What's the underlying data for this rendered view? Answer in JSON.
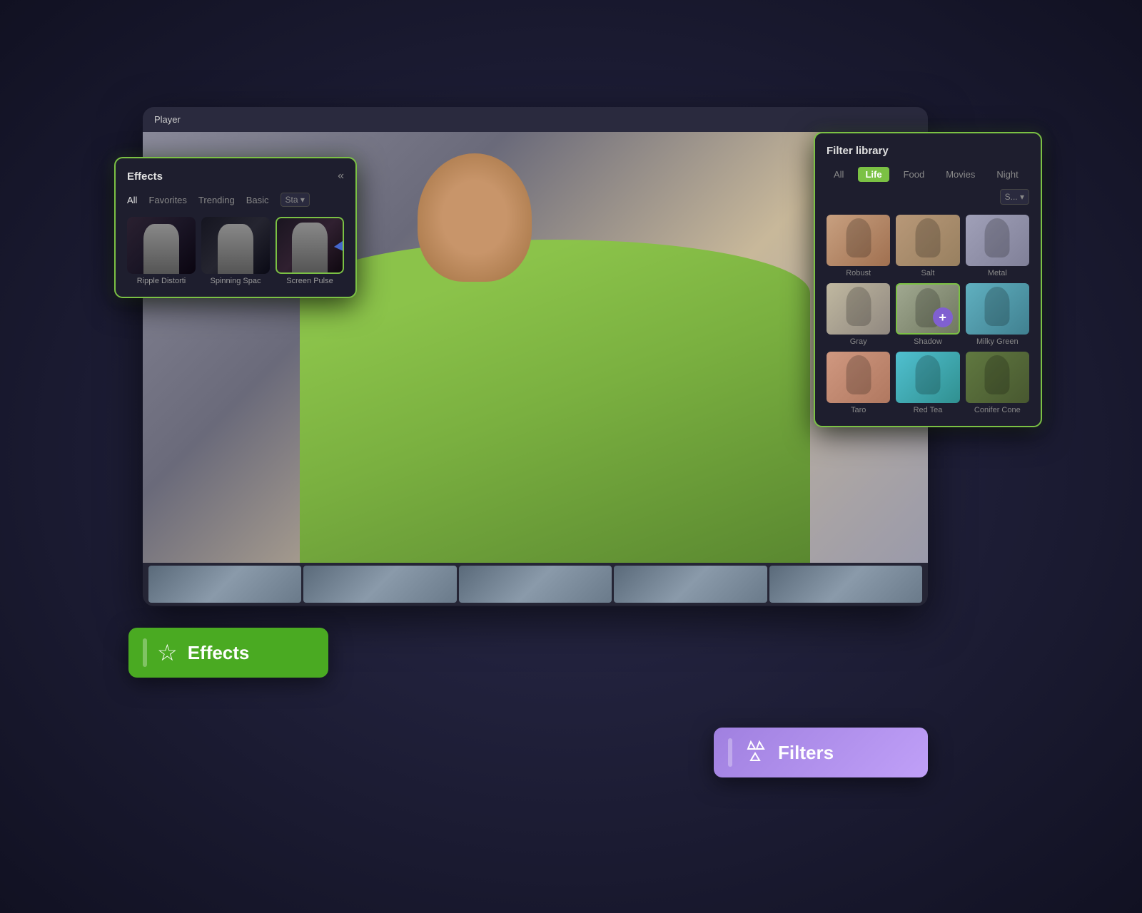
{
  "player": {
    "title": "Player",
    "ratio": "16:9",
    "fullscreen_icon": "⛶"
  },
  "effects_panel": {
    "title": "Effects",
    "collapse_icon": "«",
    "tabs": [
      {
        "label": "All",
        "active": true
      },
      {
        "label": "Favorites",
        "active": false
      },
      {
        "label": "Trending",
        "active": false
      },
      {
        "label": "Basic",
        "active": false
      },
      {
        "label": "Sta...",
        "active": false
      }
    ],
    "effects": [
      {
        "label": "Ripple Distorti",
        "selected": false
      },
      {
        "label": "Spinning Spac",
        "selected": false
      },
      {
        "label": "Screen Pulse",
        "selected": true
      }
    ]
  },
  "filter_panel": {
    "title": "Filter library",
    "tabs": [
      {
        "label": "All",
        "active": false
      },
      {
        "label": "Life",
        "active": true
      },
      {
        "label": "Food",
        "active": false
      },
      {
        "label": "Movies",
        "active": false
      },
      {
        "label": "Night",
        "active": false
      },
      {
        "label": "S...",
        "active": false
      }
    ],
    "filters": [
      {
        "label": "Robust",
        "style": "warm-1"
      },
      {
        "label": "Salt",
        "style": "warm-2"
      },
      {
        "label": "Metal",
        "style": "cool-1"
      },
      {
        "label": "Gray",
        "style": "gray-1"
      },
      {
        "label": "Shadow",
        "style": "shadow-1",
        "selected": true,
        "has_add": true
      },
      {
        "label": "Milky Green",
        "style": "teal-1"
      },
      {
        "label": "Taro",
        "style": "peach-1"
      },
      {
        "label": "Red Tea",
        "style": "aqua-1"
      },
      {
        "label": "Conifer Cone",
        "style": "green-1"
      }
    ]
  },
  "effects_badge": {
    "icon": "☆",
    "text": "Effects"
  },
  "filters_badge": {
    "icon": "♻",
    "text": "Filters"
  },
  "icons": {
    "star": "✦",
    "chevron_down": "▾",
    "plus": "+",
    "collapse": "«",
    "fullscreen": "⛶"
  }
}
